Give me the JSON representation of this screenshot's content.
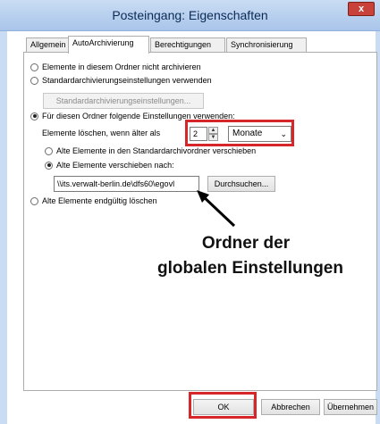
{
  "window": {
    "title": "Posteingang: Eigenschaften",
    "close_symbol": "x",
    "colors": {
      "titlebar": "#b7cff0",
      "highlight": "#d6262a"
    }
  },
  "tabs": [
    {
      "label": "Allgemein",
      "active": false
    },
    {
      "label": "AutoArchivierung",
      "active": true
    },
    {
      "label": "Berechtigungen",
      "active": false
    },
    {
      "label": "Synchronisierung",
      "active": false
    }
  ],
  "options": {
    "no_archive": "Elemente in diesem Ordner nicht archivieren",
    "use_default": "Standardarchivierungseinstellungen verwenden",
    "default_settings_button": "Standardarchivierungseinstellungen...",
    "custom_settings": "Für diesen Ordner folgende Einstellungen verwenden:",
    "delete_older_label": "Elemente löschen, wenn älter als",
    "age_value": "2",
    "age_unit": "Monate",
    "move_to_default": "Alte Elemente in den Standardarchivordner verschieben",
    "move_to": "Alte Elemente verschieben nach:",
    "path_value": "\\\\its.verwalt-berlin.de\\dfs60\\egovl",
    "browse_button": "Durchsuchen...",
    "delete_permanently": "Alte Elemente endgültig löschen"
  },
  "annotation": {
    "line1": "Ordner der",
    "line2": "globalen Einstellungen"
  },
  "footer": {
    "ok": "OK",
    "cancel": "Abbrechen",
    "apply": "Übernehmen"
  }
}
